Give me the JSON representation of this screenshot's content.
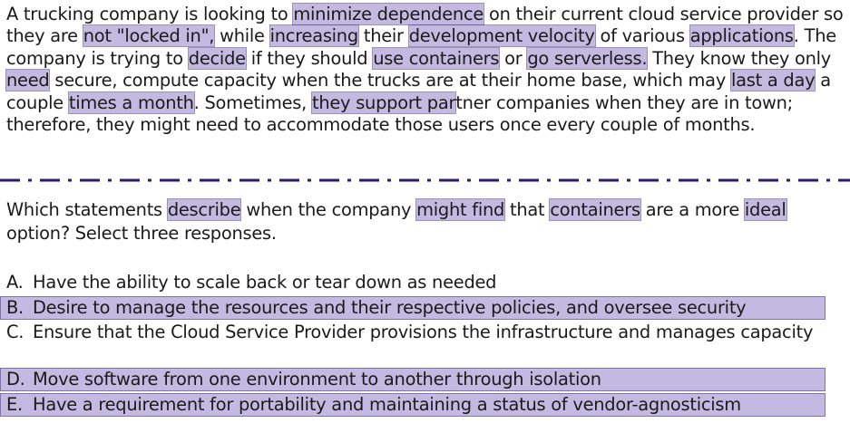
{
  "scenario": {
    "s1": "A trucking company is looking to ",
    "h1": "minimize dependence",
    "s2": " on their current cloud service provider so they are ",
    "h2": "not \"locked in\",",
    "s3": " while ",
    "h3": "increasing",
    "s4": " their ",
    "h4": "development velocity",
    "s5": " of various ",
    "h5": "applications",
    "s6": ". The company is trying to ",
    "h6": "decide",
    "s7": " if they should ",
    "h7": "use containers",
    "s8": " or ",
    "h8": "go serverless.",
    "s9": " They know they only ",
    "h9": "need",
    "s10": " secure, compute capacity when the trucks are at their home base, which may ",
    "h10": "last a day",
    "s11": " a couple ",
    "h11": "times a month",
    "s12": ". Sometimes, ",
    "h12": "they support par",
    "s13": "tner companies when they are in town; therefore, they might need to accommodate those users once every couple of months."
  },
  "question": {
    "q1": "Which statements ",
    "qh1": "describe",
    "q2": " when the company ",
    "qh2": "might find",
    "q3": " that ",
    "qh3": "containers",
    "q4": " are a more ",
    "qh4": "ideal",
    "q5": " option? Select three responses."
  },
  "options": [
    {
      "label": "A.",
      "text": "Have the ability to scale back or tear down as needed",
      "highlighted": false
    },
    {
      "label": "B.",
      "text": "Desire to manage the resources and their respective policies, and oversee security",
      "highlighted": true
    },
    {
      "label": "C.",
      "text": "Ensure that the Cloud Service Provider provisions the infrastructure and manages capacity",
      "highlighted": false
    },
    {
      "label": "D.",
      "text": "Move software from one environment to another through isolation",
      "highlighted": true
    },
    {
      "label": "E.",
      "text": "Have a requirement for portability and maintaining a status of vendor-agnosticism",
      "highlighted": true
    }
  ],
  "colors": {
    "highlight": "#b0a2d6",
    "divider": "#2d1a6e",
    "text": "#1a1a1a"
  }
}
